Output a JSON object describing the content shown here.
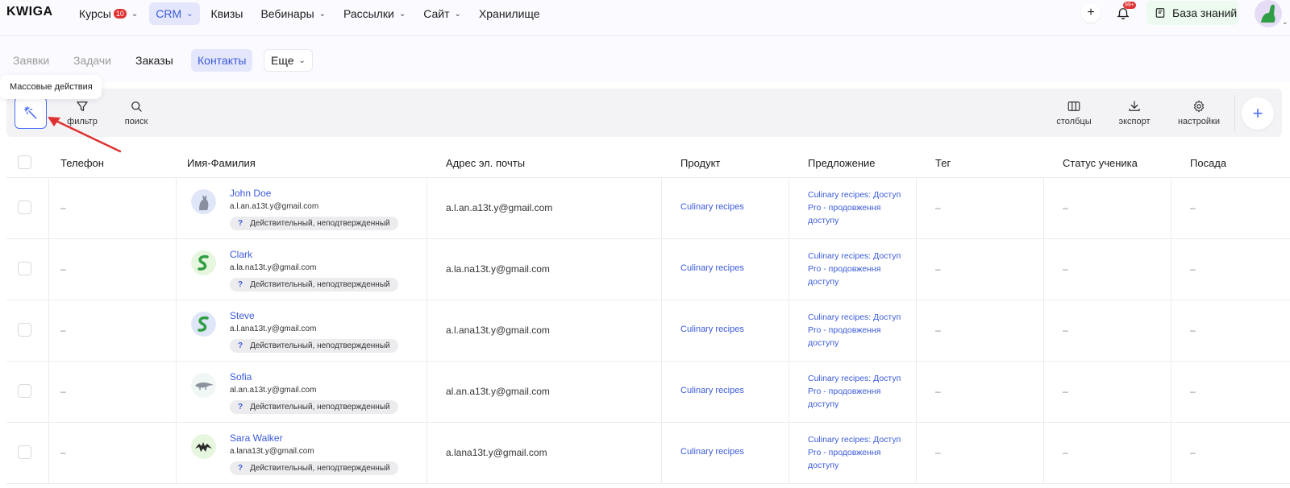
{
  "logo": "KWIGA",
  "nav": [
    {
      "label": "Курсы",
      "badge": "10",
      "chevron": true,
      "active": false
    },
    {
      "label": "CRM",
      "chevron": true,
      "active": true
    },
    {
      "label": "Квизы",
      "chevron": false,
      "active": false
    },
    {
      "label": "Вебинары",
      "chevron": true,
      "active": false
    },
    {
      "label": "Рассылки",
      "chevron": true,
      "active": false
    },
    {
      "label": "Сайт",
      "chevron": true,
      "active": false
    },
    {
      "label": "Хранилище",
      "chevron": false,
      "active": false
    }
  ],
  "top_right": {
    "notification_badge": "99+",
    "knowledge_base": "База знаний"
  },
  "subnav": {
    "tabs": [
      "Заявки",
      "Задачи",
      "Заказы",
      "Контакты"
    ],
    "more": "Еще"
  },
  "tooltip": "Массовые действия",
  "toolbar": {
    "filter": "фильтр",
    "search": "поиск",
    "columns": "столбцы",
    "export": "экспорт",
    "settings": "настройки"
  },
  "table": {
    "headers": [
      "Телефон",
      "Имя-Фамилия",
      "Адрес эл. почты",
      "Продукт",
      "Предложение",
      "Тег",
      "Статус ученика",
      "Посада"
    ],
    "rows": [
      {
        "phone": "–",
        "name": "John Doe",
        "email_small": "a.l.an.a13t.y@gmail.com",
        "status": "Действительный, неподтвержденный",
        "email": "a.l.an.a13t.y@gmail.com",
        "product": "Culinary recipes",
        "offer": "Culinary recipes: Доступ Pro - продовження доступу",
        "tag": "–",
        "student_status": "–",
        "position": "–",
        "avatar": "cat"
      },
      {
        "phone": "–",
        "name": "Clark",
        "email_small": "a.la.na13t.y@gmail.com",
        "status": "Действительный, неподтвержденный",
        "email": "a.la.na13t.y@gmail.com",
        "product": "Culinary recipes",
        "offer": "Culinary recipes: Доступ Pro - продовження доступу",
        "tag": "–",
        "student_status": "–",
        "position": "–",
        "avatar": "snake-green"
      },
      {
        "phone": "–",
        "name": "Steve",
        "email_small": "a.l.ana13t.y@gmail.com",
        "status": "Действительный, неподтвержденный",
        "email": "a.l.ana13t.y@gmail.com",
        "product": "Culinary recipes",
        "offer": "Culinary recipes: Доступ Pro - продовження доступу",
        "tag": "–",
        "student_status": "–",
        "position": "–",
        "avatar": "snake-blue"
      },
      {
        "phone": "–",
        "name": "Sofia",
        "email_small": "al.an.a13t.y@gmail.com",
        "status": "Действительный, неподтвержденный",
        "email": "al.an.a13t.y@gmail.com",
        "product": "Culinary recipes",
        "offer": "Culinary recipes: Доступ Pro - продовження доступу",
        "tag": "–",
        "student_status": "–",
        "position": "–",
        "avatar": "anteater"
      },
      {
        "phone": "–",
        "name": "Sara Walker",
        "email_small": "a.lana13t.y@gmail.com",
        "status": "Действительный, неподтвержденный",
        "email": "a.lana13t.y@gmail.com",
        "product": "Culinary recipes",
        "offer": "Culinary recipes: Доступ Pro - продовження доступу",
        "tag": "–",
        "student_status": "–",
        "position": "–",
        "avatar": "bat"
      }
    ]
  }
}
